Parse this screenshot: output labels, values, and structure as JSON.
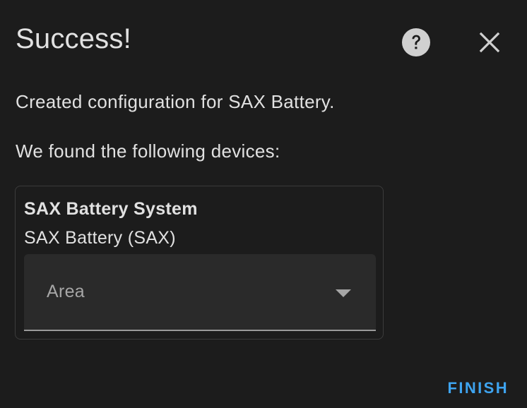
{
  "dialog": {
    "title": "Success!",
    "help_icon": "help-circle-icon",
    "close_icon": "close-icon",
    "created_message": "Created configuration for SAX Battery.",
    "found_message": "We found the following devices:",
    "finish_label": "FINISH"
  },
  "device": {
    "name": "SAX Battery System",
    "model": "SAX Battery (SAX)",
    "area_field": {
      "label": "Area",
      "value": "",
      "icon": "chevron-down-icon"
    }
  },
  "colors": {
    "background": "#1c1c1c",
    "text": "#e1e1e1",
    "muted_text": "#a6a6a6",
    "field_background": "#2a2a2a",
    "accent": "#3ea4f0",
    "card_border": "#3b3b3b",
    "icon": "#d0d0d0"
  }
}
